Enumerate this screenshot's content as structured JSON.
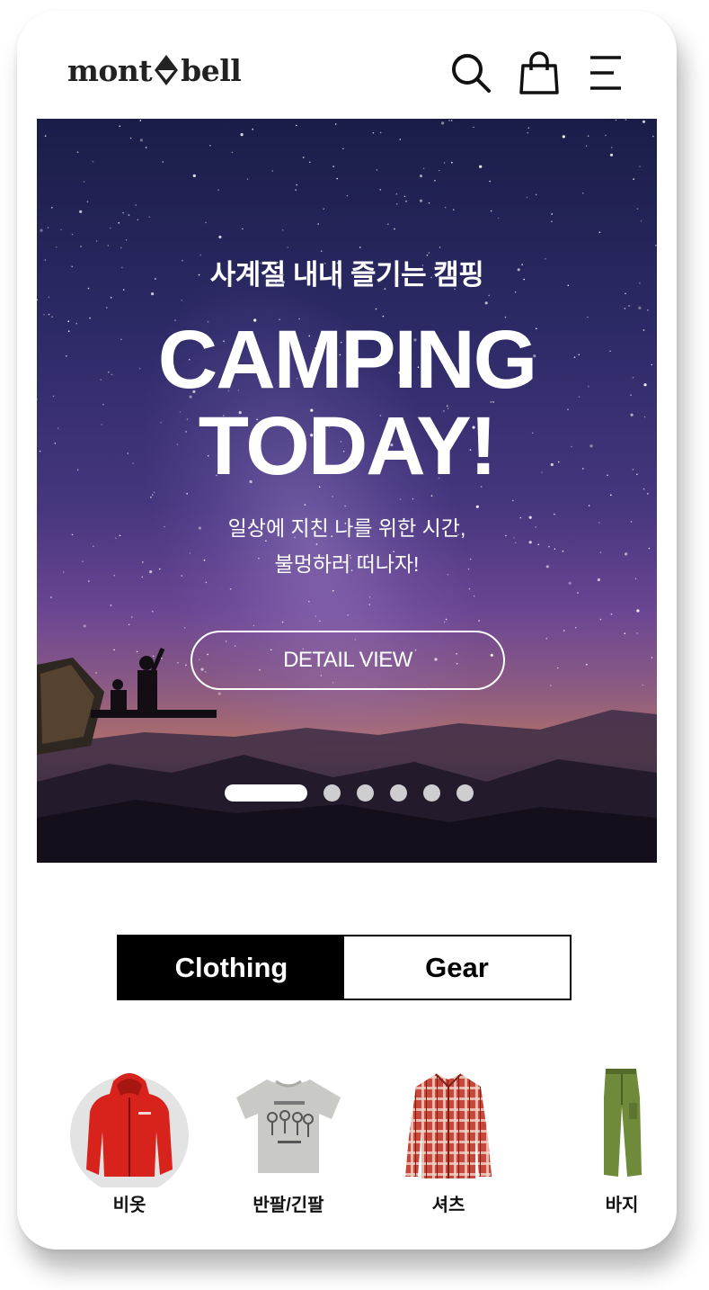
{
  "header": {
    "logo_left": "mont",
    "logo_right": "bell",
    "icons": [
      "search-icon",
      "shopping-bag-icon",
      "menu-icon"
    ]
  },
  "hero": {
    "subtitle": "사계절 내내 즐기는 캠핑",
    "title_line1": "CAMPING",
    "title_line2": "TODAY!",
    "desc_line1": "일상에 지친 나를 위한 시간,",
    "desc_line2": "불멍하러 떠나자!",
    "button_label": "DETAIL VIEW",
    "slide_count": 6,
    "active_slide": 1
  },
  "tabs": [
    {
      "label": "Clothing",
      "active": true
    },
    {
      "label": "Gear",
      "active": false
    }
  ],
  "categories": [
    {
      "label": "비옷",
      "icon": "rain-jacket-icon",
      "selected": true
    },
    {
      "label": "반팔/긴팔",
      "icon": "tshirt-icon",
      "selected": false
    },
    {
      "label": "셔츠",
      "icon": "plaid-shirt-icon",
      "selected": false
    },
    {
      "label": "바지",
      "icon": "pants-icon",
      "selected": false
    }
  ],
  "colors": {
    "accent": "#000000",
    "jacket": "#d8231c",
    "tshirt": "#c9c9c6",
    "shirt": "#c9463a",
    "pants": "#6f8a3a"
  }
}
